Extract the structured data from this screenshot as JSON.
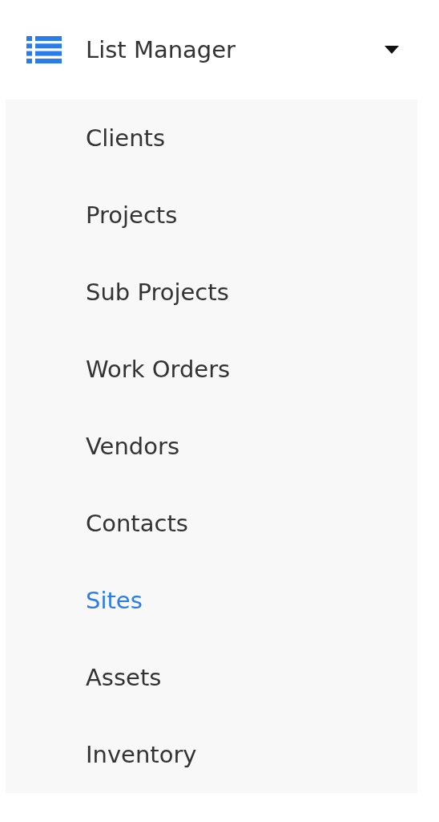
{
  "menu": {
    "title": "List Manager",
    "expanded": true,
    "items": [
      {
        "label": "Clients",
        "selected": false
      },
      {
        "label": "Projects",
        "selected": false
      },
      {
        "label": "Sub Projects",
        "selected": false
      },
      {
        "label": "Work Orders",
        "selected": false
      },
      {
        "label": "Vendors",
        "selected": false
      },
      {
        "label": "Contacts",
        "selected": false
      },
      {
        "label": "Sites",
        "selected": true
      },
      {
        "label": "Assets",
        "selected": false
      },
      {
        "label": "Inventory",
        "selected": false
      }
    ]
  }
}
